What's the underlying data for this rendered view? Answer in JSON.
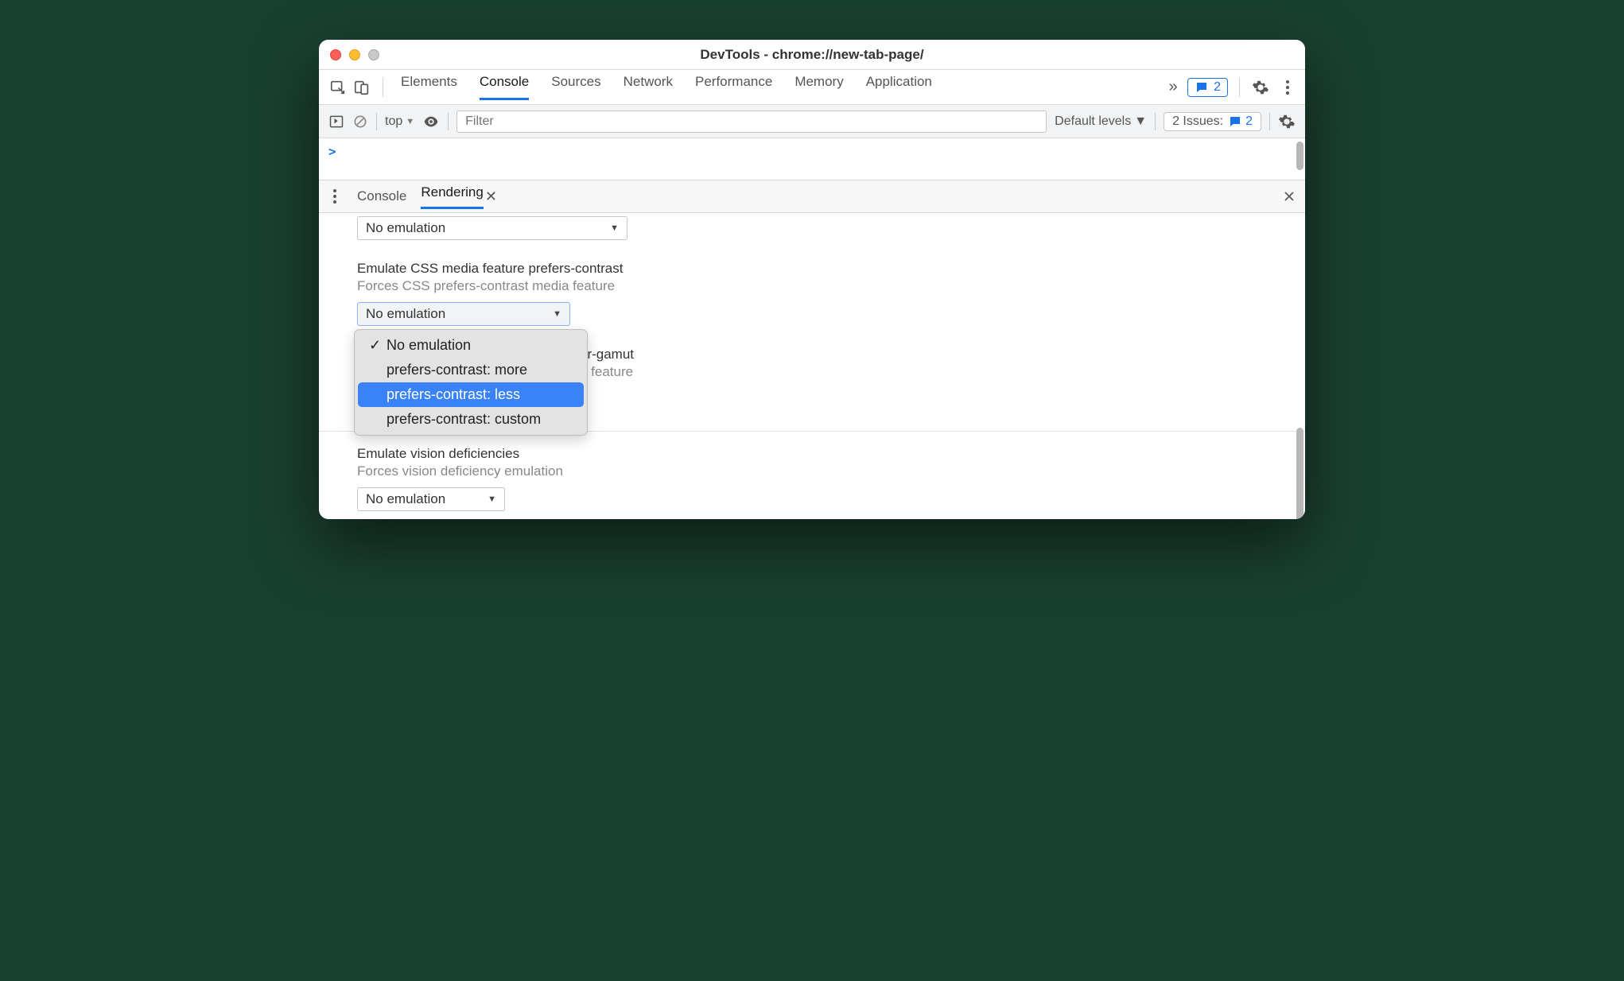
{
  "window": {
    "title": "DevTools - chrome://new-tab-page/"
  },
  "tabs": {
    "items": [
      "Elements",
      "Console",
      "Sources",
      "Network",
      "Performance",
      "Memory",
      "Application"
    ],
    "active_index": 1,
    "message_badge_count": "2"
  },
  "console_bar": {
    "context": "top",
    "filter_placeholder": "Filter",
    "levels_label": "Default levels",
    "issues_label": "2 Issues:",
    "issues_count": "2"
  },
  "drawer": {
    "tabs": [
      "Console",
      "Rendering"
    ],
    "active_index": 1
  },
  "rendering": {
    "select_above": {
      "value": "No emulation"
    },
    "contrast_section": {
      "title": "Emulate CSS media feature prefers-contrast",
      "subtitle": "Forces CSS prefers-contrast media feature",
      "select_value": "No emulation",
      "options": [
        {
          "label": "No emulation",
          "checked": true
        },
        {
          "label": "prefers-contrast: more",
          "checked": false
        },
        {
          "label": "prefers-contrast: less",
          "checked": false,
          "highlighted": true
        },
        {
          "label": "prefers-contrast: custom",
          "checked": false
        }
      ]
    },
    "gamut_fragment_title": "or-gamut",
    "gamut_fragment_subtitle": "a feature",
    "vision_section": {
      "title": "Emulate vision deficiencies",
      "subtitle": "Forces vision deficiency emulation",
      "select_value": "No emulation"
    }
  }
}
